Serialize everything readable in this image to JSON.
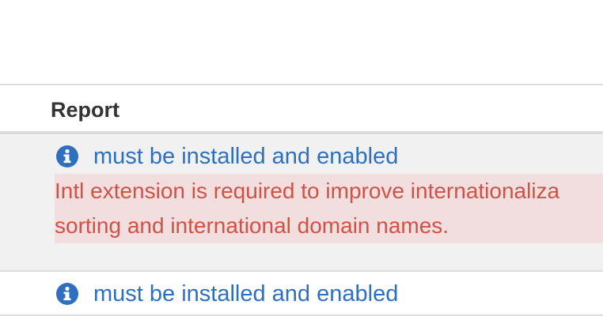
{
  "table": {
    "header": "Report",
    "rows": [
      {
        "icon": "info-circle-icon",
        "status": "must be installed and enabled",
        "message_line_1": "Intl extension is required to improve internationaliza",
        "message_line_2": "sorting and international domain names."
      },
      {
        "icon": "info-circle-icon",
        "status": "must be installed and enabled"
      }
    ]
  },
  "colors": {
    "link_blue": "#2f6fc0",
    "alert_background": "#f2dede",
    "alert_text": "#cf5247",
    "row_shade": "#f1f1f1",
    "heading_text": "#333333"
  }
}
